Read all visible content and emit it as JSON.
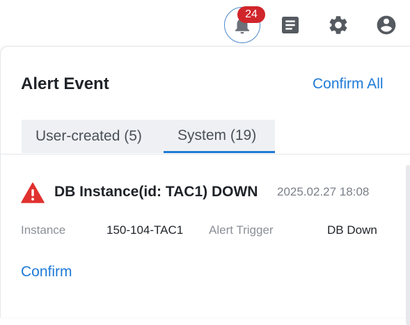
{
  "header": {
    "notification_count": "24",
    "icons": [
      "bell-icon",
      "document-icon",
      "gear-icon",
      "account-circle-icon"
    ]
  },
  "panel": {
    "title": "Alert Event",
    "confirm_all_label": "Confirm All",
    "tabs": [
      {
        "label": "User-created (5)",
        "active": false
      },
      {
        "label": "System (19)",
        "active": true
      }
    ]
  },
  "events": [
    {
      "title": "DB Instance(id: TAC1) DOWN",
      "timestamp": "2025.02.27 18:08",
      "instance_label": "Instance",
      "instance_value": "150-104-TAC1",
      "trigger_label": "Alert Trigger",
      "trigger_value": "DB Down",
      "confirm_label": "Confirm",
      "severity_icon": "warning-triangle-icon"
    }
  ],
  "colors": {
    "accent": "#1f7ad6",
    "badge": "#d0262b",
    "warning": "#e0312f"
  }
}
